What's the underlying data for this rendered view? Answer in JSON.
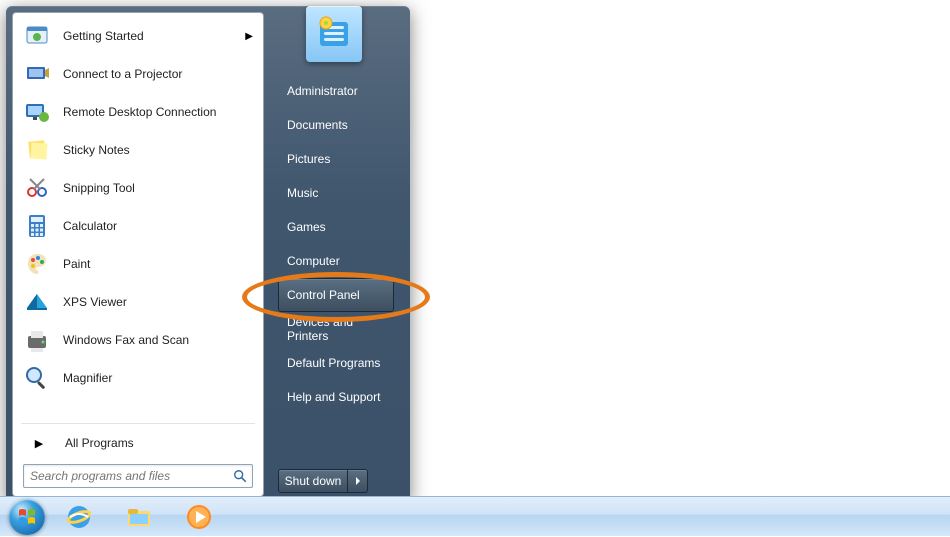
{
  "pinned": [
    {
      "label": "Getting Started",
      "icon": "getting-started",
      "hasSubmenu": true
    },
    {
      "label": "Connect to a Projector",
      "icon": "projector"
    },
    {
      "label": "Remote Desktop Connection",
      "icon": "remote-desktop"
    },
    {
      "label": "Sticky Notes",
      "icon": "sticky-notes"
    },
    {
      "label": "Snipping Tool",
      "icon": "snipping-tool"
    },
    {
      "label": "Calculator",
      "icon": "calculator"
    },
    {
      "label": "Paint",
      "icon": "paint"
    },
    {
      "label": "XPS Viewer",
      "icon": "xps-viewer"
    },
    {
      "label": "Windows Fax and Scan",
      "icon": "fax-scan"
    },
    {
      "label": "Magnifier",
      "icon": "magnifier"
    }
  ],
  "allPrograms": "All Programs",
  "search": {
    "placeholder": "Search programs and files"
  },
  "right": [
    {
      "label": "Administrator"
    },
    {
      "label": "Documents"
    },
    {
      "label": "Pictures"
    },
    {
      "label": "Music"
    },
    {
      "label": "Games"
    },
    {
      "label": "Computer"
    },
    {
      "label": "Control Panel",
      "highlight": true
    },
    {
      "label": "Devices and Printers"
    },
    {
      "label": "Default Programs"
    },
    {
      "label": "Help and Support"
    }
  ],
  "shutdown": {
    "label": "Shut down"
  },
  "taskbar": {
    "pinned": [
      {
        "name": "internet-explorer"
      },
      {
        "name": "file-explorer"
      },
      {
        "name": "media-player"
      }
    ]
  },
  "annotation": {
    "target": "Control Panel"
  }
}
